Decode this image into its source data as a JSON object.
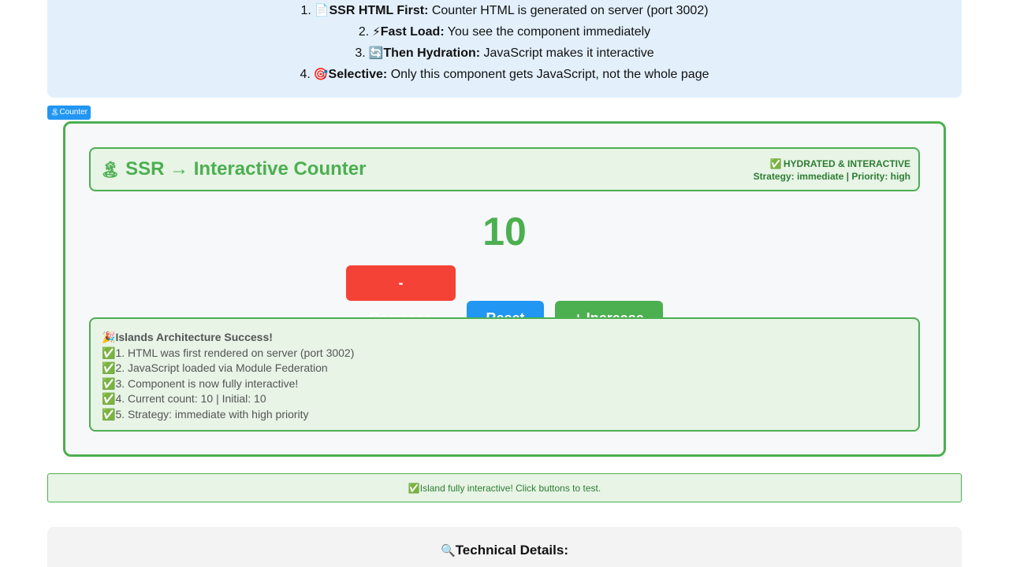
{
  "info": {
    "steps": [
      {
        "num": "1.",
        "icon": "📄",
        "bold": "SSR HTML First:",
        "text": " Counter HTML is generated on server (port 3002)"
      },
      {
        "num": "2.",
        "icon": "⚡",
        "bold": "Fast Load:",
        "text": " You see the component immediately"
      },
      {
        "num": "3.",
        "icon": "🔄",
        "bold": "Then Hydration:",
        "text": " JavaScript makes it interactive"
      },
      {
        "num": "4.",
        "icon": "🎯",
        "bold": "Selective:",
        "text": " Only this component gets JavaScript, not the whole page"
      }
    ]
  },
  "island_badge": {
    "icon": "🏝",
    "label": "Counter"
  },
  "counter": {
    "title_icon": "🏝",
    "title": "SSR → Interactive Counter",
    "status": "HYDRATED & INTERACTIVE",
    "status_icon": "✅",
    "strategy": "Strategy: immediate | Priority: high",
    "value": "10",
    "buttons": {
      "decrease": "- Decrease",
      "reset": "Reset",
      "increase": "+ Increase"
    }
  },
  "success": {
    "title_icon": "🎉",
    "title": "Islands Architecture Success!",
    "check_icon": "✅",
    "items": [
      "1. HTML was first rendered on server (port 3002)",
      "2. JavaScript loaded via Module Federation",
      "3. Component is now fully interactive!",
      "4. Current count: 10 | Initial: 10",
      "5. Strategy: immediate with high priority"
    ]
  },
  "toast": {
    "icon": "✅",
    "text": "Island fully interactive! Click buttons to test."
  },
  "technical": {
    "icon": "🔍",
    "title": "Technical Details:"
  },
  "colors": {
    "success_green": "#4caf50",
    "danger_red": "#f44336",
    "primary_blue": "#2196f3",
    "info_bg": "#e3f0fc"
  }
}
